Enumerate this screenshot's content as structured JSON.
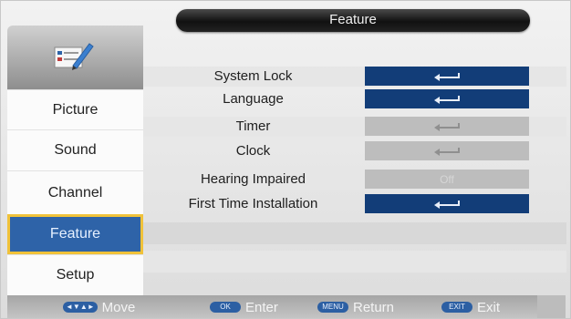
{
  "header": {
    "title": "Feature"
  },
  "sidebar": {
    "items": [
      {
        "label": "Picture"
      },
      {
        "label": "Sound"
      },
      {
        "label": "Channel"
      },
      {
        "label": "Feature",
        "selected": true
      },
      {
        "label": "Setup"
      }
    ]
  },
  "options": [
    {
      "label": "System Lock",
      "value_icon": "enter-arrow-icon",
      "enabled": true
    },
    {
      "label": "Language",
      "value_icon": "enter-arrow-icon",
      "enabled": true
    },
    {
      "label": "Timer",
      "value_icon": "enter-arrow-icon",
      "enabled": false
    },
    {
      "label": "Clock",
      "value_icon": "enter-arrow-icon",
      "enabled": false
    },
    {
      "label": "Hearing Impaired",
      "value_text": "Off",
      "enabled": false
    },
    {
      "label": "First Time Installation",
      "value_icon": "enter-arrow-icon",
      "enabled": true
    }
  ],
  "footer": {
    "hints": [
      {
        "key": "◄▼▲►",
        "label": "Move"
      },
      {
        "key": "OK",
        "label": "Enter"
      },
      {
        "key": "MENU",
        "label": "Return"
      },
      {
        "key": "EXIT",
        "label": "Exit"
      }
    ]
  },
  "colors": {
    "selected_blue": "#2e63a8",
    "selected_border": "#f0c23a",
    "value_enabled": "#123d78",
    "value_disabled": "#bdbdbd"
  }
}
